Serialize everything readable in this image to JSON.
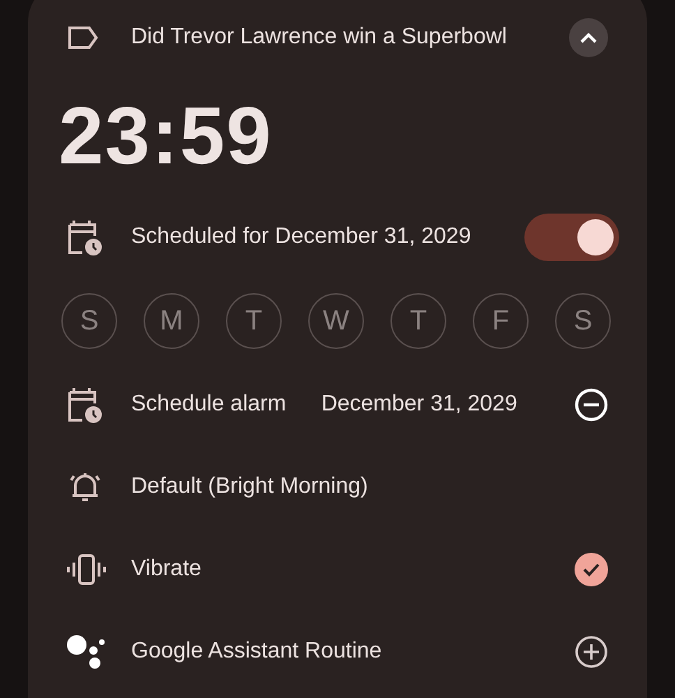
{
  "label": {
    "text": "Did Trevor Lawrence win a Superbowl",
    "expanded": true
  },
  "time": "23:59",
  "schedule_toggle": {
    "label": "Scheduled for December 31, 2029",
    "on": true
  },
  "days": [
    {
      "letter": "S",
      "selected": false
    },
    {
      "letter": "M",
      "selected": false
    },
    {
      "letter": "T",
      "selected": false
    },
    {
      "letter": "W",
      "selected": false
    },
    {
      "letter": "T",
      "selected": false
    },
    {
      "letter": "F",
      "selected": false
    },
    {
      "letter": "S",
      "selected": false
    }
  ],
  "settings": [
    {
      "kind": "date",
      "label": "Schedule alarm",
      "value": "December 31, 2029"
    },
    {
      "kind": "sound",
      "label": "Default (Bright Morning)"
    },
    {
      "kind": "vibrate",
      "label": "Vibrate",
      "checked": true
    },
    {
      "kind": "assistant",
      "label": "Google Assistant Routine"
    }
  ]
}
